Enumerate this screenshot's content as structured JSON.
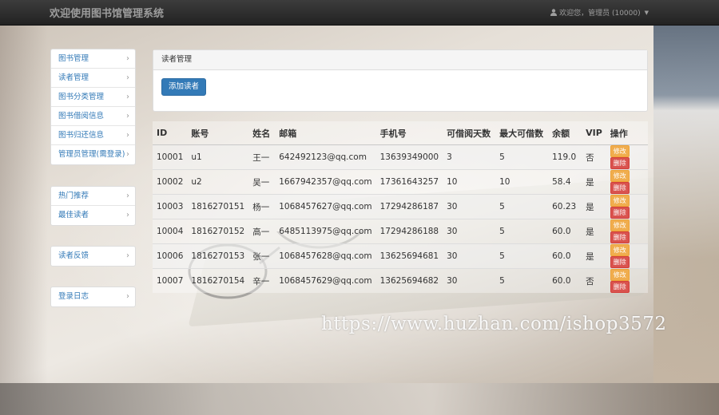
{
  "navbar": {
    "brand": "欢迎使用图书馆管理系统",
    "user_label": "欢迎您，管理员 (10000)"
  },
  "sidebar": {
    "group1": [
      {
        "label": "图书管理"
      },
      {
        "label": "读者管理"
      },
      {
        "label": "图书分类管理"
      },
      {
        "label": "图书借阅信息"
      },
      {
        "label": "图书归还信息"
      },
      {
        "label": "管理员管理(需登录)"
      }
    ],
    "group2": [
      {
        "label": "热门推荐"
      },
      {
        "label": "最佳读者"
      }
    ],
    "group3": [
      {
        "label": "读者反馈"
      }
    ],
    "group4": [
      {
        "label": "登录日志"
      }
    ]
  },
  "panel": {
    "heading": "读者管理",
    "add_button": "添加读者"
  },
  "table": {
    "columns": [
      "ID",
      "账号",
      "姓名",
      "邮箱",
      "手机号",
      "可借阅天数",
      "最大可借数",
      "余额",
      "VIP",
      "操作"
    ],
    "edit_label": "修改",
    "delete_label": "删除",
    "rows": [
      {
        "id": "10001",
        "account": "u1",
        "name": "王一",
        "email": "642492123@qq.com",
        "phone": "13639349000",
        "days": "3",
        "max": "5",
        "balance": "119.0",
        "vip": "否"
      },
      {
        "id": "10002",
        "account": "u2",
        "name": "吴一",
        "email": "1667942357@qq.com",
        "phone": "17361643257",
        "days": "10",
        "max": "10",
        "balance": "58.4",
        "vip": "是"
      },
      {
        "id": "10003",
        "account": "1816270151",
        "name": "杨一",
        "email": "1068457627@qq.com",
        "phone": "17294286187",
        "days": "30",
        "max": "5",
        "balance": "60.23",
        "vip": "是"
      },
      {
        "id": "10004",
        "account": "1816270152",
        "name": "高一",
        "email": "6485113975@qq.com",
        "phone": "17294286188",
        "days": "30",
        "max": "5",
        "balance": "60.0",
        "vip": "是"
      },
      {
        "id": "10006",
        "account": "1816270153",
        "name": "张一",
        "email": "1068457628@qq.com",
        "phone": "13625694681",
        "days": "30",
        "max": "5",
        "balance": "60.0",
        "vip": "是"
      },
      {
        "id": "10007",
        "account": "1816270154",
        "name": "辛一",
        "email": "1068457629@qq.com",
        "phone": "13625694682",
        "days": "30",
        "max": "5",
        "balance": "60.0",
        "vip": "否"
      }
    ]
  },
  "watermark": "https://www.huzhan.com/ishop3572",
  "colors": {
    "navbar": "#222222",
    "primary": "#337ab7",
    "edit": "#f0ad4e",
    "delete": "#d9534f"
  }
}
